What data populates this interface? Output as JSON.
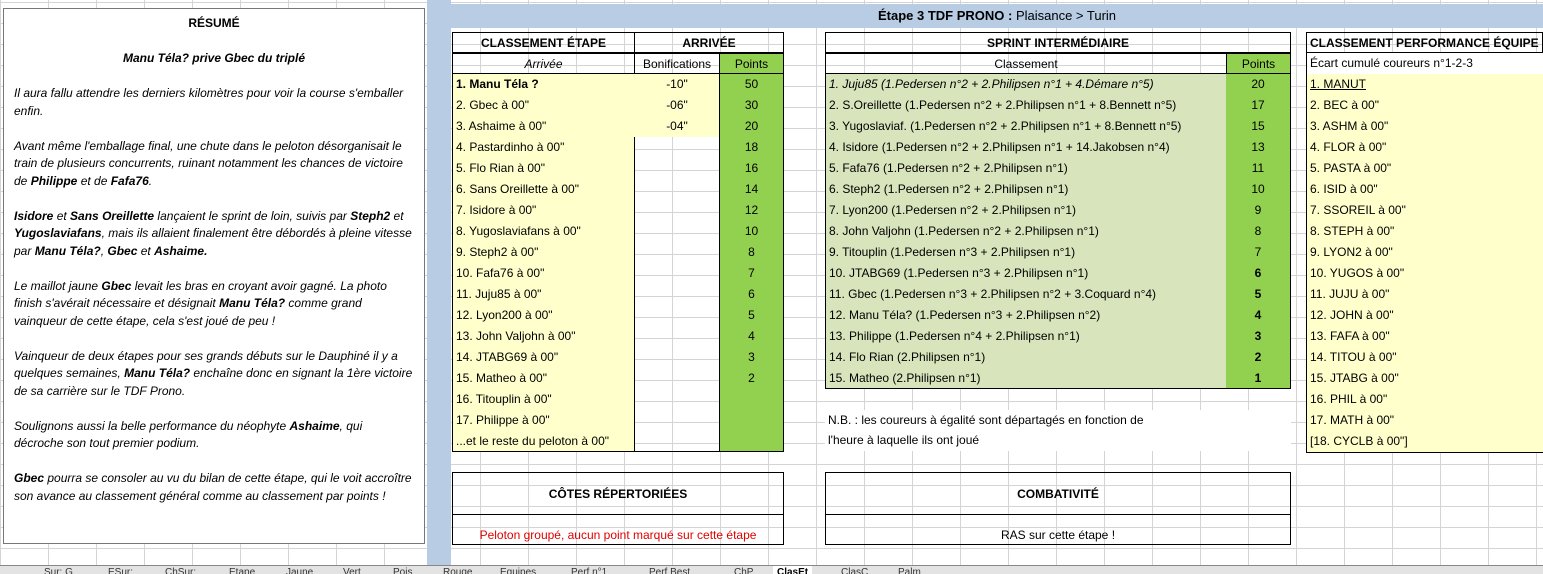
{
  "resume": {
    "title": "RÉSUMÉ",
    "subtitle": "Manu Téla? prive Gbec du triplé",
    "p1": "Il aura fallu attendre les derniers kilomètres pour voir la course s'emballer enfin.",
    "p2a": "Avant même l'emballage final, une chute dans le peloton désorganisait le train de plusieurs concurrents, ruinant notamment les chances de victoire de ",
    "p2b": "Philippe",
    "p2c": " et de ",
    "p2d": "Fafa76",
    "p2e": ".",
    "p3a": "Isidore",
    "p3b": " et ",
    "p3c": "Sans Oreillette",
    "p3d": " lançaient le sprint de loin, suivis par ",
    "p3e": "Steph2",
    "p3f": " et ",
    "p3g": "Yugoslaviafans",
    "p3h": ", mais ils allaient finalement être débordés à pleine vitesse par ",
    "p3i": "Manu Téla?",
    "p3j": ", ",
    "p3k": "Gbec",
    "p3l": " et ",
    "p3m": "Ashaime.",
    "p4a": "Le maillot jaune ",
    "p4b": "Gbec",
    "p4c": " levait les bras en croyant avoir gagné. La photo finish s'avérait nécessaire et désignait ",
    "p4d": "Manu Téla?",
    "p4e": " comme grand vainqueur de cette étape, cela s'est joué de peu !",
    "p5a": "Vainqueur de deux étapes pour ses grands débuts sur le Dauphiné il y a quelques semaines, ",
    "p5b": "Manu Téla?",
    "p5c": " enchaîne donc en signant la 1ère victoire de sa carrière sur le TDF Prono.",
    "p6a": "Soulignons aussi la belle performance du néophyte ",
    "p6b": "Ashaime",
    ", ": "",
    "p6c": ", qui décroche son tout premier podium.",
    "p7a": "Gbec",
    "p7b": " pourra se consoler au vu du bilan de cette étape, qui le voit accroître son avance au classement général comme au classement par points !"
  },
  "banner": {
    "bold": "Étape 3 TDF PRONO :",
    "rest": " Plaisance > Turin"
  },
  "stage": {
    "h1": "CLASSEMENT ÉTAPE",
    "h2": "ARRIVÉE",
    "sub1": "Arrivée",
    "sub2": "Bonifications",
    "sub3": "Points",
    "rows": [
      {
        "name": "1. Manu Téla ?",
        "bonus": "-10\"",
        "pts": "50"
      },
      {
        "name": "2. Gbec à 00\"",
        "bonus": "-06\"",
        "pts": "30"
      },
      {
        "name": "3. Ashaime à 00\"",
        "bonus": "-04\"",
        "pts": "20"
      },
      {
        "name": "4. Pastardinho à 00\"",
        "bonus": "",
        "pts": "18"
      },
      {
        "name": "5. Flo Rian à 00\"",
        "bonus": "",
        "pts": "16"
      },
      {
        "name": "6. Sans Oreillette à 00\"",
        "bonus": "",
        "pts": "14"
      },
      {
        "name": "7. Isidore à 00\"",
        "bonus": "",
        "pts": "12"
      },
      {
        "name": "8. Yugoslaviafans à 00\"",
        "bonus": "",
        "pts": "10"
      },
      {
        "name": "9. Steph2 à 00\"",
        "bonus": "",
        "pts": "8"
      },
      {
        "name": "10. Fafa76 à 00\"",
        "bonus": "",
        "pts": "7"
      },
      {
        "name": "11. Juju85 à 00\"",
        "bonus": "",
        "pts": "6"
      },
      {
        "name": "12. Lyon200 à 00\"",
        "bonus": "",
        "pts": "5"
      },
      {
        "name": "13. John Valjohn à 00\"",
        "bonus": "",
        "pts": "4"
      },
      {
        "name": "14. JTABG69 à 00\"",
        "bonus": "",
        "pts": "3"
      },
      {
        "name": "15. Matheo à 00\"",
        "bonus": "",
        "pts": "2"
      },
      {
        "name": "16. Titouplin à 00\"",
        "bonus": "",
        "pts": ""
      },
      {
        "name": "17. Philippe à 00\"",
        "bonus": "",
        "pts": ""
      },
      {
        "name": "...et le reste du peloton à 00\"",
        "bonus": "",
        "pts": ""
      }
    ]
  },
  "sprint": {
    "h": "SPRINT INTERMÉDIAIRE",
    "sub1": "Classement",
    "sub2": "Points",
    "rows": [
      {
        "name": "1. Juju85 (1.Pedersen n°2 + 2.Philipsen n°1 + 4.Démare n°5)",
        "pts": "20"
      },
      {
        "name": "2. S.Oreillette (1.Pedersen n°2 + 2.Philipsen n°1 + 8.Bennett n°5)",
        "pts": "17"
      },
      {
        "name": "3. Yugoslaviaf. (1.Pedersen n°2 + 2.Philipsen n°1 + 8.Bennett n°5)",
        "pts": "15"
      },
      {
        "name": "4. Isidore (1.Pedersen n°2 + 2.Philipsen n°1 + 14.Jakobsen n°4)",
        "pts": "13"
      },
      {
        "name": "5. Fafa76 (1.Pedersen n°2 + 2.Philipsen n°1)",
        "pts": "11"
      },
      {
        "name": "6. Steph2 (1.Pedersen n°2 + 2.Philipsen n°1)",
        "pts": "10"
      },
      {
        "name": "7. Lyon200 (1.Pedersen n°2 + 2.Philipsen n°1)",
        "pts": "9"
      },
      {
        "name": "8. John Valjohn  (1.Pedersen n°2 + 2.Philipsen n°1)",
        "pts": "8"
      },
      {
        "name": "9. Titouplin  (1.Pedersen n°3 + 2.Philipsen n°1)",
        "pts": "7"
      },
      {
        "name": "10. JTABG69  (1.Pedersen n°3 + 2.Philipsen n°1)",
        "pts": "6"
      },
      {
        "name": "11. Gbec  (1.Pedersen n°3 + 2.Philipsen n°2 + 3.Coquard n°4)",
        "pts": "5"
      },
      {
        "name": "12. Manu Téla? (1.Pedersen n°3 + 2.Philipsen n°2)",
        "pts": "4"
      },
      {
        "name": "13. Philippe (1.Pedersen n°4 + 2.Philipsen n°1)",
        "pts": "3"
      },
      {
        "name": "14. Flo Rian (2.Philipsen n°1)",
        "pts": "2"
      },
      {
        "name": "15. Matheo (2.Philipsen n°1)",
        "pts": "1"
      }
    ],
    "nb1": "N.B. : les coureurs à égalité sont départagés en fonction de",
    "nb2": "l'heure à laquelle ils ont joué"
  },
  "team": {
    "h": "CLASSEMENT PERFORMANCE ÉQUIPE",
    "sub": "Écart cumulé coureurs n°1-2-3",
    "rows": [
      "1. MANUT",
      "2. BEC à 00\"",
      "3. ASHM à 00\"",
      "4. FLOR à 00\"",
      "5. PASTA à 00\"",
      "6. ISID à 00\"",
      "7. SSOREIL à 00\"",
      "8. STEPH à 00\"",
      "9. LYON2 à 00\"",
      "10. YUGOS à 00\"",
      "11. JUJU à 00\"",
      "12. JOHN à 00\"",
      "13. FAFA à 00\"",
      "14. TITOU à 00\"",
      "15. JTABG à 00\"",
      "16. PHIL à 00\"",
      "17. MATH à 00\"",
      "[18. CYCLB à 00\"]"
    ]
  },
  "cotes": {
    "h": "CÔTES RÉPERTORIÉES",
    "txt": "Peloton groupé, aucun point marqué sur cette étape"
  },
  "comba": {
    "h": "COMBATIVITÉ",
    "txt": "RAS sur cette étape !"
  },
  "tabs": [
    "Sur: G",
    "ESur:",
    "ChSur:",
    "Etape",
    "Jaune",
    "Vert",
    "Pois",
    "Rouge",
    "Equipes",
    "Perf n°1",
    "Perf Best",
    "ChP",
    "ClasEt",
    "ClasC",
    "Palm"
  ],
  "active_tab": "ClasEt"
}
